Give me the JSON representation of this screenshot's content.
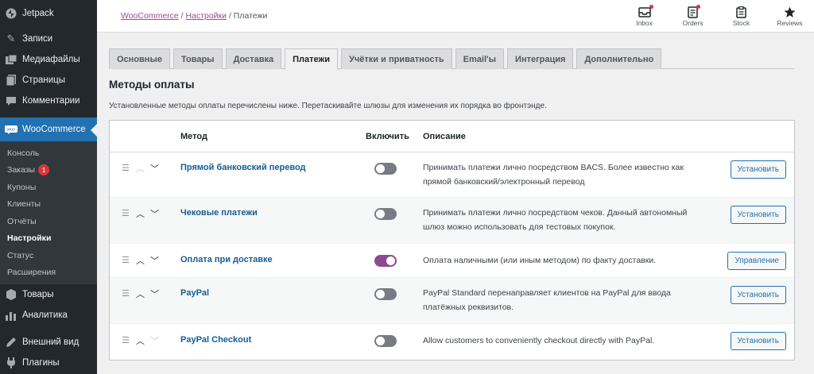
{
  "sidebar": {
    "top_items": [
      {
        "icon": "jetpack-icon",
        "label": "Jetpack"
      },
      {
        "icon": "pin-icon",
        "label": "Записи"
      },
      {
        "icon": "media-icon",
        "label": "Медиафайлы"
      },
      {
        "icon": "pages-icon",
        "label": "Страницы"
      },
      {
        "icon": "comments-icon",
        "label": "Комментарии"
      }
    ],
    "woocommerce": {
      "icon": "woo-icon",
      "label": "WooCommerce"
    },
    "submenu": [
      {
        "label": "Консоль"
      },
      {
        "label": "Заказы",
        "badge": "1"
      },
      {
        "label": "Купоны"
      },
      {
        "label": "Клиенты"
      },
      {
        "label": "Отчёты"
      },
      {
        "label": "Настройки"
      },
      {
        "label": "Статус"
      },
      {
        "label": "Расширения"
      }
    ],
    "bottom_items": [
      {
        "icon": "products-icon",
        "label": "Товары"
      },
      {
        "icon": "analytics-icon",
        "label": "Аналитика"
      },
      {
        "icon": "appearance-icon",
        "label": "Внешний вид"
      },
      {
        "icon": "plugins-icon",
        "label": "Плагины"
      }
    ]
  },
  "breadcrumb": {
    "link1": "WooCommerce",
    "sep": "/",
    "link2": "Настройки",
    "current": "Платежи"
  },
  "header_buttons": [
    {
      "icon": "inbox-icon",
      "label": "Inbox"
    },
    {
      "icon": "orders-icon",
      "label": "Orders"
    },
    {
      "icon": "stock-icon",
      "label": "Stock"
    },
    {
      "icon": "reviews-icon",
      "label": "Reviews"
    }
  ],
  "tabs": [
    "Основные",
    "Товары",
    "Доставка",
    "Платежи",
    "Учётки и приватность",
    "Email'ы",
    "Интеграция",
    "Дополнительно"
  ],
  "active_tab": "Платежи",
  "section": {
    "title": "Методы оплаты",
    "description": "Установленные методы оплаты перечислены ниже. Перетаскивайте шлюзы для изменения их порядка во фронтэнде."
  },
  "table": {
    "headers": {
      "method": "Метод",
      "enable": "Включить",
      "description": "Описание"
    },
    "rows": [
      {
        "name": "Прямой банковский перевод",
        "enabled": false,
        "description": "Принимать платежи лично посредством BACS. Более известно как прямой банковский/электронный перевод",
        "button": "Установить"
      },
      {
        "name": "Чековые платежи",
        "enabled": false,
        "description": "Принимать платежи лично посредством чеков. Данный автономный шлюз можно использовать для тестовых покупок.",
        "button": "Установить"
      },
      {
        "name": "Оплата при доставке",
        "enabled": true,
        "description": "Оплата наличными (или иным методом) по факту доставки.",
        "button": "Управление"
      },
      {
        "name": "PayPal",
        "enabled": false,
        "description": "PayPal Standard перенаправляет клиентов на PayPal для ввода платёжных реквизитов.",
        "button": "Установить"
      },
      {
        "name": "PayPal Checkout",
        "enabled": false,
        "description": "Allow customers to conveniently checkout directly with PayPal.",
        "button": "Установить"
      }
    ]
  },
  "colors": {
    "sidebar_bg": "#23282d",
    "active_menu": "#2271b1",
    "link": "#135e96",
    "toggle_on": "#8c4990",
    "breadcrumb_link": "#a34796"
  }
}
